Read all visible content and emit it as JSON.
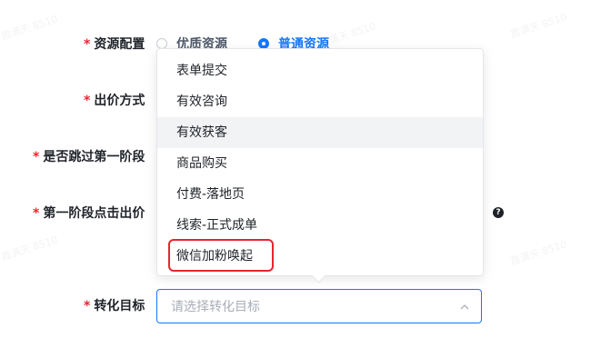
{
  "form": {
    "resource_config": {
      "label": "资源配置",
      "option_premium": "优质资源",
      "option_normal": "普通资源",
      "selected": "普通资源"
    },
    "bid_method": {
      "label": "出价方式"
    },
    "skip_stage_one": {
      "label": "是否跳过第一阶段"
    },
    "stage_one_bid": {
      "label": "第一阶段点击出价"
    },
    "conversion_goal": {
      "label": "转化目标",
      "placeholder": "请选择转化目标"
    },
    "required_mark": "*"
  },
  "dropdown": {
    "options": [
      "表单提交",
      "有效咨询",
      "有效获客",
      "商品购买",
      "付费-落地页",
      "线索-正式成单",
      "微信加粉唤起"
    ],
    "hovered": "有效获客",
    "highlighted": "微信加粉唤起"
  },
  "icons": {
    "help": "question-circle-icon",
    "chevron": "chevron-up-icon"
  },
  "watermark": "霞满天 8510",
  "colors": {
    "primary": "#1677ff",
    "required": "#f5222d",
    "highlight": "#e5262d"
  }
}
